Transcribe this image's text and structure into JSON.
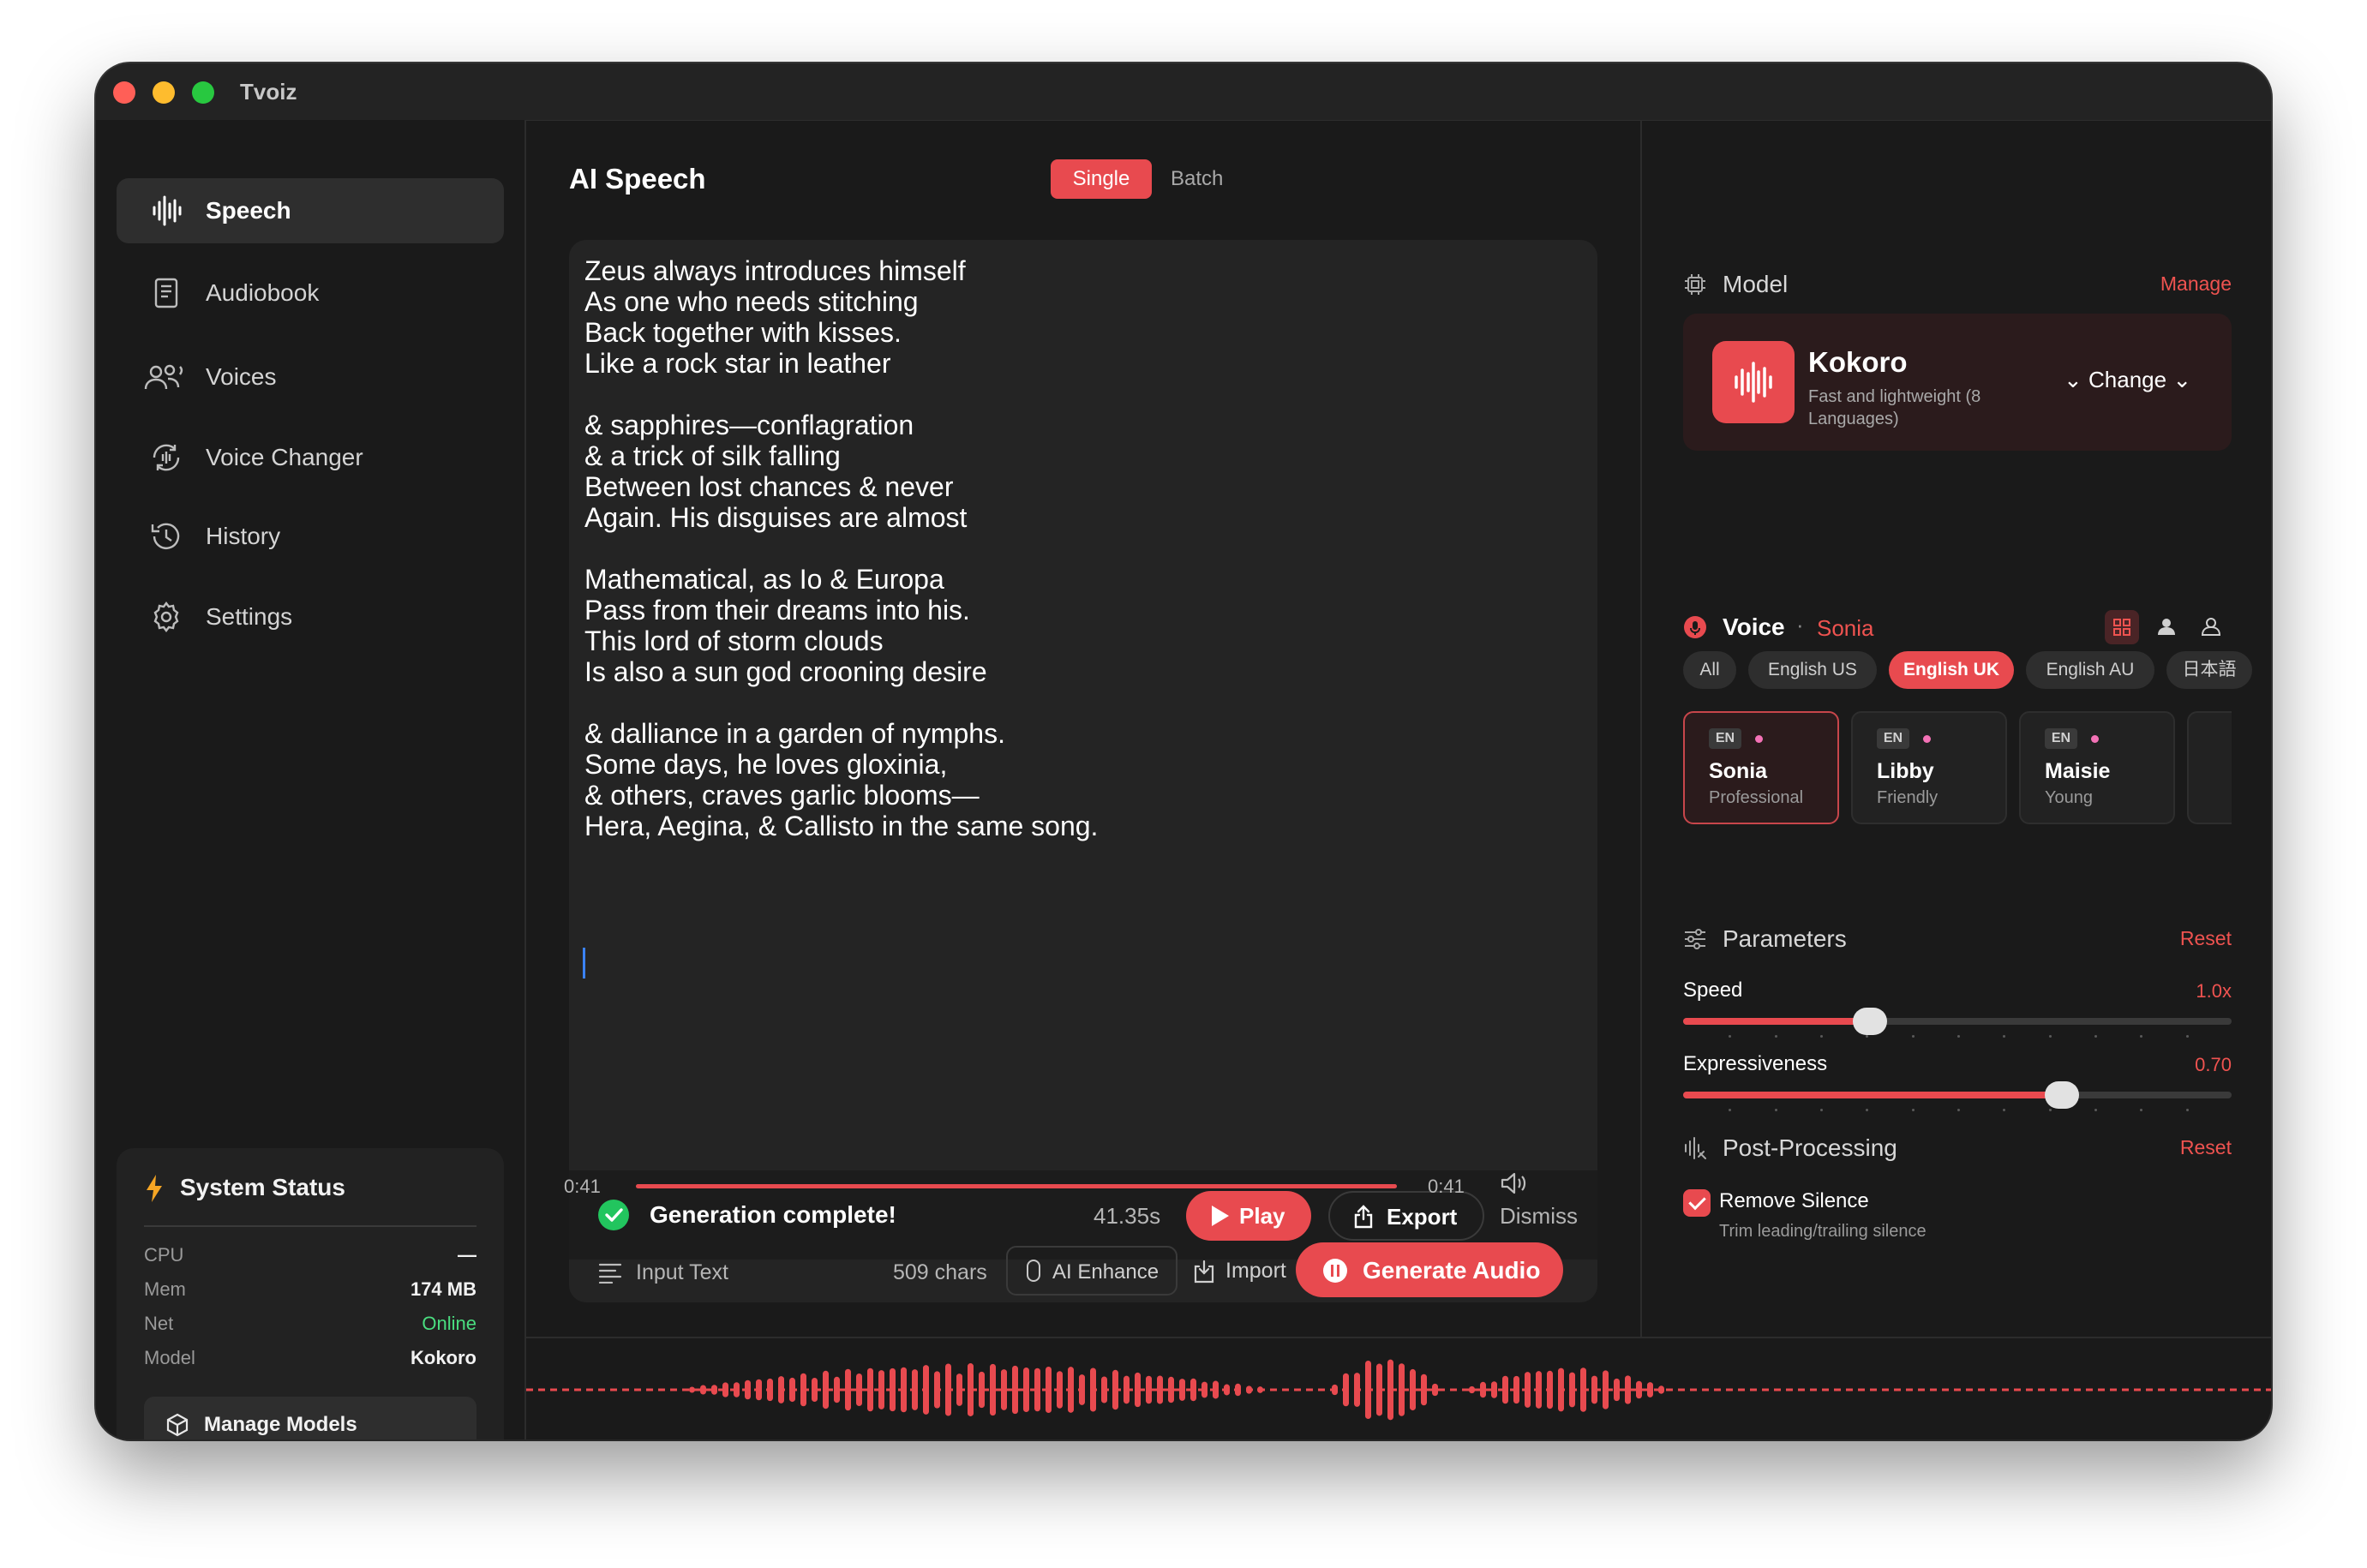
{
  "window": {
    "title": "Tvoiz"
  },
  "sidebar": {
    "items": [
      {
        "label": "Speech",
        "icon": "waveform-icon",
        "active": true
      },
      {
        "label": "Audiobook",
        "icon": "book-icon",
        "active": false
      },
      {
        "label": "Voices",
        "icon": "people-icon",
        "active": false
      },
      {
        "label": "Voice Changer",
        "icon": "voice-changer-icon",
        "active": false
      },
      {
        "label": "History",
        "icon": "history-icon",
        "active": false
      },
      {
        "label": "Settings",
        "icon": "gear-icon",
        "active": false
      }
    ],
    "system_status": {
      "title": "System Status",
      "rows": [
        {
          "key": "CPU",
          "value": "—"
        },
        {
          "key": "Mem",
          "value": "174 MB"
        },
        {
          "key": "Net",
          "value": "Online"
        },
        {
          "key": "Model",
          "value": "Kokoro"
        }
      ],
      "manage_models": "Manage Models"
    }
  },
  "main": {
    "title": "AI Speech",
    "modes": [
      "Single",
      "Batch"
    ],
    "active_mode": "Single",
    "text": "Zeus always introduces himself\nAs one who needs stitching\nBack together with kisses.\nLike a rock star in leather\n\n& sapphires—conflagration\n& a trick of silk falling\nBetween lost chances & never\nAgain. His disguises are almost\n\nMathematical, as Io & Europa\nPass from their dreams into his.\nThis lord of storm clouds\nIs also a sun god crooning desire\n\n& dalliance in a garden of nymphs.\nSome days, he loves gloxinia,\n& others, craves garlic blooms—\nHera, Aegina, & Callisto in the same song.",
    "generation": {
      "status": "Generation complete!",
      "duration": "41.35s",
      "play": "Play",
      "export": "Export",
      "dismiss": "Dismiss",
      "current_time": "0:41",
      "total_time": "0:41",
      "progress": 1.0
    },
    "footer": {
      "input_label": "Input Text",
      "chars": "509 chars",
      "ai_enhance": "AI Enhance",
      "import": "Import",
      "generate": "Generate Audio"
    }
  },
  "right": {
    "model": {
      "section": "Model",
      "manage": "Manage",
      "name": "Kokoro",
      "description": "Fast and lightweight (8 Languages)",
      "change": "Change"
    },
    "voice": {
      "section": "Voice",
      "selected": "Sonia",
      "filters": [
        "All",
        "English US",
        "English UK",
        "English AU",
        "日本語"
      ],
      "active_filter": "English UK",
      "cards": [
        {
          "lang": "EN",
          "name": "Sonia",
          "style": "Professional",
          "selected": true
        },
        {
          "lang": "EN",
          "name": "Libby",
          "style": "Friendly",
          "selected": false
        },
        {
          "lang": "EN",
          "name": "Maisie",
          "style": "Young",
          "selected": false
        }
      ]
    },
    "parameters": {
      "section": "Parameters",
      "reset": "Reset",
      "speed": {
        "label": "Speed",
        "value": "1.0x",
        "level": 0.34
      },
      "expressiveness": {
        "label": "Expressiveness",
        "value": "0.70",
        "level": 0.69
      }
    },
    "post_processing": {
      "section": "Post-Processing",
      "reset": "Reset",
      "remove_silence": {
        "label": "Remove Silence",
        "description": "Trim leading/trailing silence",
        "checked": true
      }
    }
  },
  "colors": {
    "accent": "#e84a4f",
    "success": "#22c55e",
    "online": "#4ade80",
    "background": "#1a1a1a",
    "panel": "#242424"
  }
}
